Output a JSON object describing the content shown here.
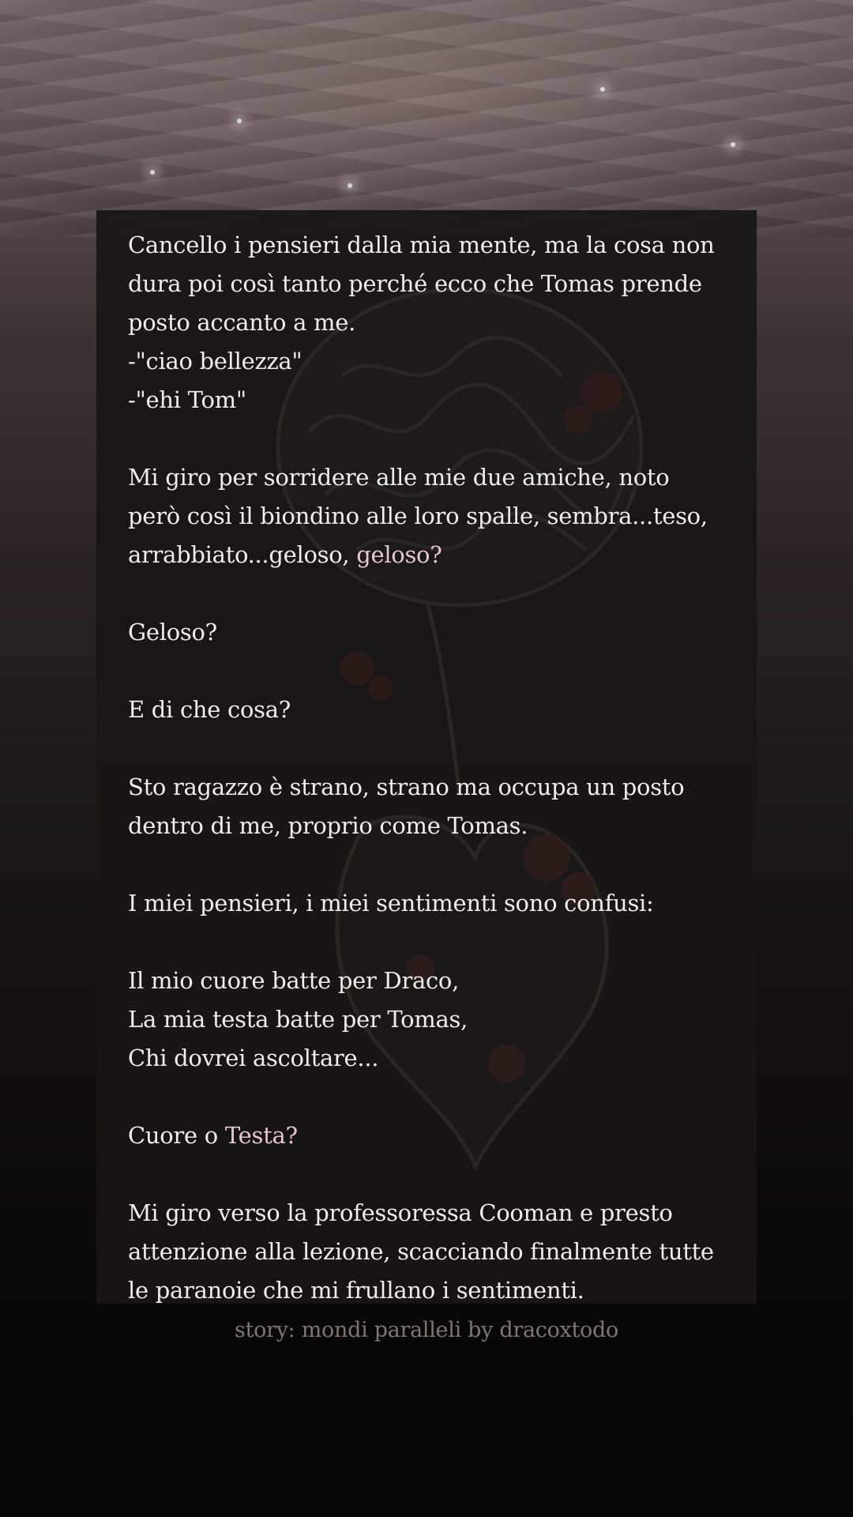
{
  "story": {
    "paragraphs": [
      {
        "lines": [
          "Cancello i pensieri dalla mia mente, ma la cosa non",
          "dura poi così tanto perché ecco che Tomas prende",
          "posto accanto a me.",
          "-\"ciao bellezza\"",
          "-\"ehi Tom\""
        ]
      },
      {
        "lines": [
          "Mi giro per sorridere alle mie due amiche, noto",
          "però così il biondino alle loro spalle, sembra...teso,"
        ],
        "last_line_prefix": "arrabbiato...geloso, ",
        "last_line_accent": "geloso?"
      },
      {
        "lines": [
          "Geloso?"
        ]
      },
      {
        "lines": [
          "E di che cosa?"
        ]
      },
      {
        "lines": [
          "Sto ragazzo è strano, strano ma occupa un posto",
          "dentro di me, proprio come Tomas."
        ]
      },
      {
        "lines": [
          "I miei pensieri, i miei sentimenti sono confusi:"
        ]
      },
      {
        "lines": [
          "Il mio cuore batte per Draco,",
          "La mia testa batte per Tomas,",
          "Chi dovrei ascoltare..."
        ]
      },
      {
        "lines": [],
        "last_line_prefix": "Cuore o ",
        "last_line_accent": "Testa?"
      },
      {
        "lines": [
          "Mi giro verso la professoressa Cooman e presto",
          "attenzione alla lezione, scacciando finalmente tutte",
          "le paranoie che mi frullano i sentimenti."
        ]
      }
    ]
  },
  "footer": {
    "credit": "story: mondi paralleli by dracoxtodo"
  },
  "colors": {
    "text": "#ededed",
    "accent_text": "#e6c7cd",
    "card_background": "#181616",
    "footer_text": "#7d7576"
  },
  "icons": [
    "brain-heart-artwork"
  ]
}
